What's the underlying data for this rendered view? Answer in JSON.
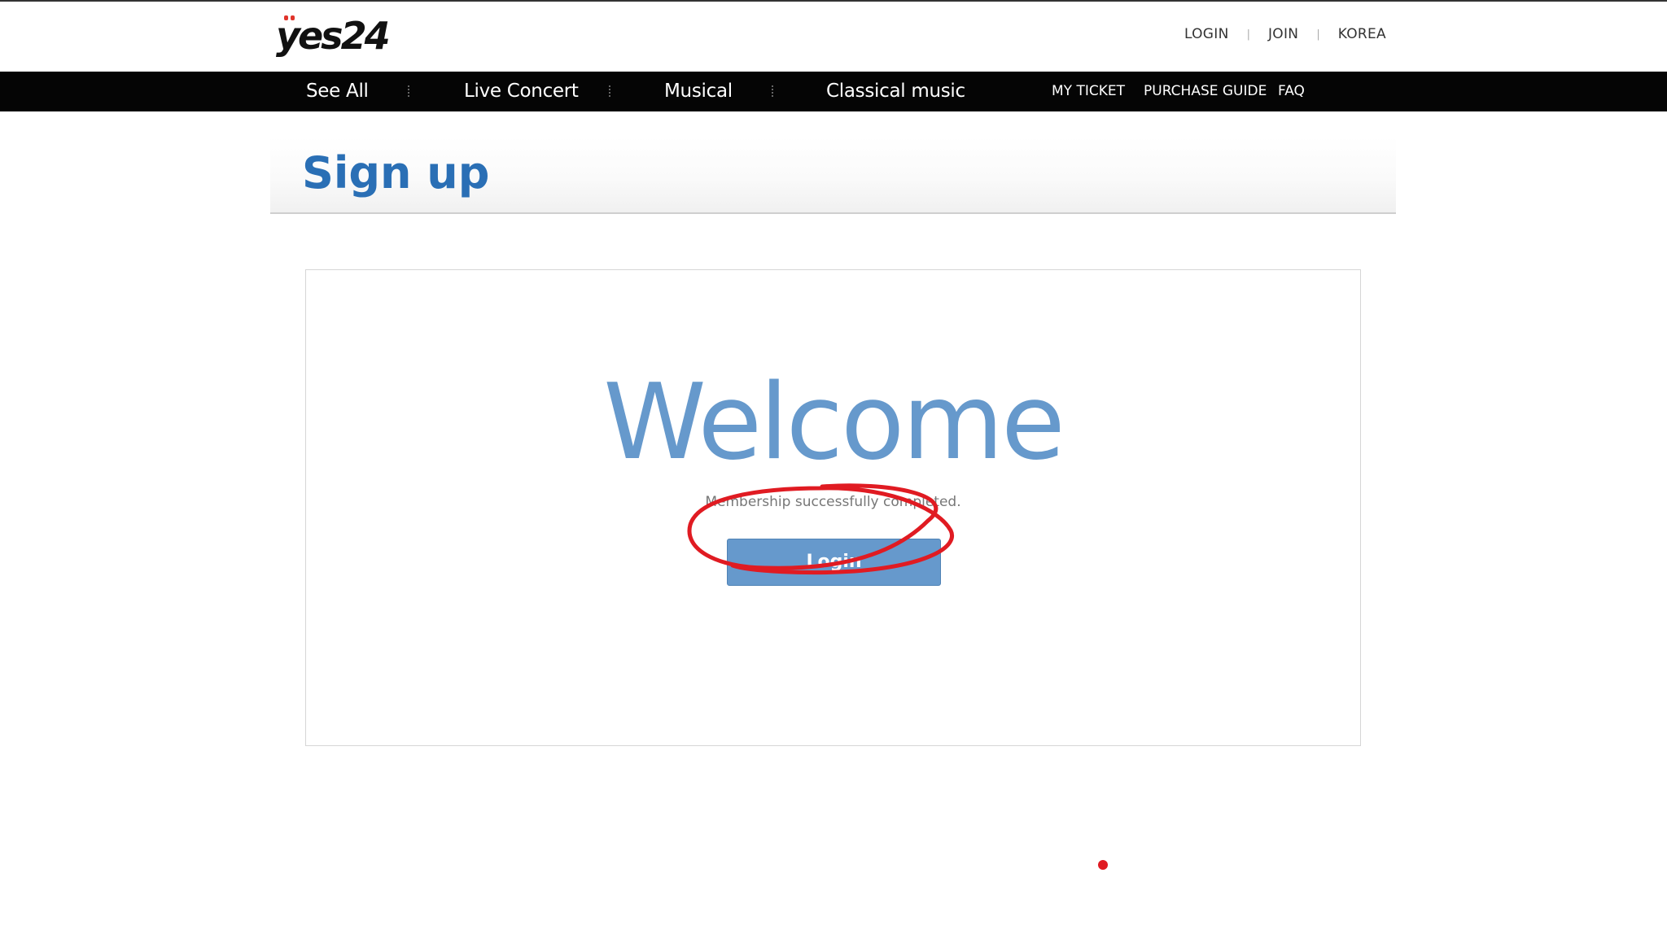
{
  "header": {
    "logo_text": "yes24",
    "util_links": [
      "LOGIN",
      "JOIN",
      "KOREA"
    ],
    "util_separator": "|"
  },
  "nav": {
    "items": [
      "See All",
      "Live Concert",
      "Musical",
      "Classical music"
    ],
    "right_items": [
      "MY TICKET",
      "PURCHASE GUIDE",
      "FAQ"
    ]
  },
  "page": {
    "title": "Sign up"
  },
  "content": {
    "welcome": "Welcome",
    "message": "Membership successfully completed.",
    "login_button": "Login"
  },
  "colors": {
    "title_blue": "#2a6fb5",
    "accent_blue": "#6699cc",
    "annotation_red": "#e01b22",
    "nav_black": "#050505"
  },
  "annotation": {
    "circle_target": "login-button",
    "marker": "red-dot"
  }
}
